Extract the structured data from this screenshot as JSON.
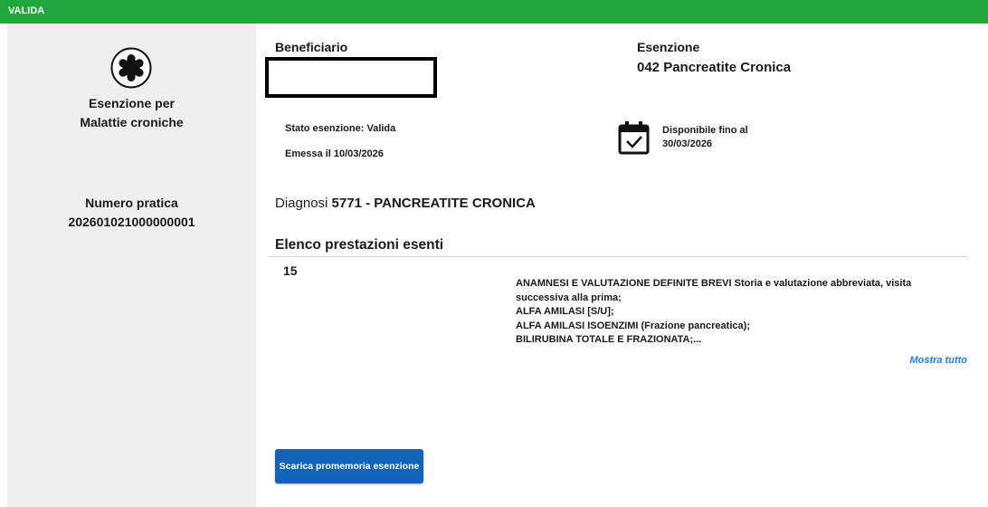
{
  "status": {
    "label": "VALIDA",
    "color": "#1fa63c"
  },
  "sidebar": {
    "icon": "asterisk-icon",
    "type_line1": "Esenzione per",
    "type_line2": "Malattie croniche",
    "practice_label": "Numero pratica",
    "practice_number": "202601021000000001"
  },
  "beneficiary": {
    "label": "Beneficiario"
  },
  "exemption": {
    "label": "Esenzione",
    "value": "042 Pancreatite Cronica"
  },
  "state": {
    "label": "Stato esenzione: ",
    "value": "Valida"
  },
  "issued": {
    "label": "Emessa il ",
    "value": "10/03/2026"
  },
  "availability": {
    "icon": "calendar-check-icon",
    "label": "Disponibile fino al",
    "value": "30/03/2026"
  },
  "diagnosis": {
    "label": "Diagnosi ",
    "value": "5771 - PANCREATITE CRONICA"
  },
  "services": {
    "title": "Elenco prestazioni esenti",
    "count": "15",
    "lines": [
      "ANAMNESI E VALUTAZIONE DEFINITE BREVI Storia e valutazione abbreviata, visita",
      "successiva alla prima;",
      "ALFA AMILASI [S/U];",
      "ALFA AMILASI ISOENZIMI (Frazione pancreatica);",
      "BILIRUBINA TOTALE E FRAZIONATA;..."
    ],
    "show_all": "Mostra tutto"
  },
  "actions": {
    "download_label": "Scarica promemoria esenzione",
    "button_color": "#1363b9"
  }
}
